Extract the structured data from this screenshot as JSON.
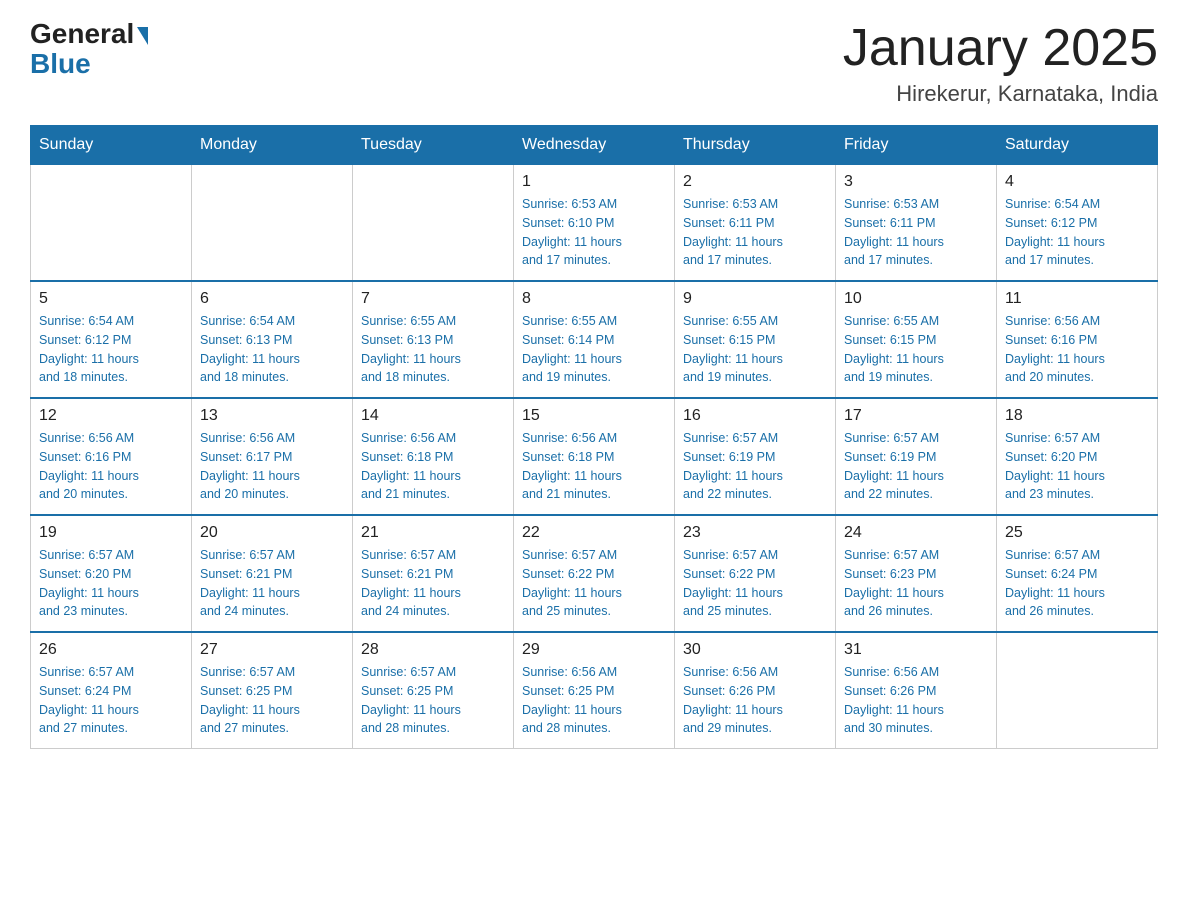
{
  "header": {
    "logo_general": "General",
    "logo_blue": "Blue",
    "title": "January 2025",
    "subtitle": "Hirekerur, Karnataka, India"
  },
  "weekdays": [
    "Sunday",
    "Monday",
    "Tuesday",
    "Wednesday",
    "Thursday",
    "Friday",
    "Saturday"
  ],
  "weeks": [
    [
      {
        "day": "",
        "info": ""
      },
      {
        "day": "",
        "info": ""
      },
      {
        "day": "",
        "info": ""
      },
      {
        "day": "1",
        "info": "Sunrise: 6:53 AM\nSunset: 6:10 PM\nDaylight: 11 hours\nand 17 minutes."
      },
      {
        "day": "2",
        "info": "Sunrise: 6:53 AM\nSunset: 6:11 PM\nDaylight: 11 hours\nand 17 minutes."
      },
      {
        "day": "3",
        "info": "Sunrise: 6:53 AM\nSunset: 6:11 PM\nDaylight: 11 hours\nand 17 minutes."
      },
      {
        "day": "4",
        "info": "Sunrise: 6:54 AM\nSunset: 6:12 PM\nDaylight: 11 hours\nand 17 minutes."
      }
    ],
    [
      {
        "day": "5",
        "info": "Sunrise: 6:54 AM\nSunset: 6:12 PM\nDaylight: 11 hours\nand 18 minutes."
      },
      {
        "day": "6",
        "info": "Sunrise: 6:54 AM\nSunset: 6:13 PM\nDaylight: 11 hours\nand 18 minutes."
      },
      {
        "day": "7",
        "info": "Sunrise: 6:55 AM\nSunset: 6:13 PM\nDaylight: 11 hours\nand 18 minutes."
      },
      {
        "day": "8",
        "info": "Sunrise: 6:55 AM\nSunset: 6:14 PM\nDaylight: 11 hours\nand 19 minutes."
      },
      {
        "day": "9",
        "info": "Sunrise: 6:55 AM\nSunset: 6:15 PM\nDaylight: 11 hours\nand 19 minutes."
      },
      {
        "day": "10",
        "info": "Sunrise: 6:55 AM\nSunset: 6:15 PM\nDaylight: 11 hours\nand 19 minutes."
      },
      {
        "day": "11",
        "info": "Sunrise: 6:56 AM\nSunset: 6:16 PM\nDaylight: 11 hours\nand 20 minutes."
      }
    ],
    [
      {
        "day": "12",
        "info": "Sunrise: 6:56 AM\nSunset: 6:16 PM\nDaylight: 11 hours\nand 20 minutes."
      },
      {
        "day": "13",
        "info": "Sunrise: 6:56 AM\nSunset: 6:17 PM\nDaylight: 11 hours\nand 20 minutes."
      },
      {
        "day": "14",
        "info": "Sunrise: 6:56 AM\nSunset: 6:18 PM\nDaylight: 11 hours\nand 21 minutes."
      },
      {
        "day": "15",
        "info": "Sunrise: 6:56 AM\nSunset: 6:18 PM\nDaylight: 11 hours\nand 21 minutes."
      },
      {
        "day": "16",
        "info": "Sunrise: 6:57 AM\nSunset: 6:19 PM\nDaylight: 11 hours\nand 22 minutes."
      },
      {
        "day": "17",
        "info": "Sunrise: 6:57 AM\nSunset: 6:19 PM\nDaylight: 11 hours\nand 22 minutes."
      },
      {
        "day": "18",
        "info": "Sunrise: 6:57 AM\nSunset: 6:20 PM\nDaylight: 11 hours\nand 23 minutes."
      }
    ],
    [
      {
        "day": "19",
        "info": "Sunrise: 6:57 AM\nSunset: 6:20 PM\nDaylight: 11 hours\nand 23 minutes."
      },
      {
        "day": "20",
        "info": "Sunrise: 6:57 AM\nSunset: 6:21 PM\nDaylight: 11 hours\nand 24 minutes."
      },
      {
        "day": "21",
        "info": "Sunrise: 6:57 AM\nSunset: 6:21 PM\nDaylight: 11 hours\nand 24 minutes."
      },
      {
        "day": "22",
        "info": "Sunrise: 6:57 AM\nSunset: 6:22 PM\nDaylight: 11 hours\nand 25 minutes."
      },
      {
        "day": "23",
        "info": "Sunrise: 6:57 AM\nSunset: 6:22 PM\nDaylight: 11 hours\nand 25 minutes."
      },
      {
        "day": "24",
        "info": "Sunrise: 6:57 AM\nSunset: 6:23 PM\nDaylight: 11 hours\nand 26 minutes."
      },
      {
        "day": "25",
        "info": "Sunrise: 6:57 AM\nSunset: 6:24 PM\nDaylight: 11 hours\nand 26 minutes."
      }
    ],
    [
      {
        "day": "26",
        "info": "Sunrise: 6:57 AM\nSunset: 6:24 PM\nDaylight: 11 hours\nand 27 minutes."
      },
      {
        "day": "27",
        "info": "Sunrise: 6:57 AM\nSunset: 6:25 PM\nDaylight: 11 hours\nand 27 minutes."
      },
      {
        "day": "28",
        "info": "Sunrise: 6:57 AM\nSunset: 6:25 PM\nDaylight: 11 hours\nand 28 minutes."
      },
      {
        "day": "29",
        "info": "Sunrise: 6:56 AM\nSunset: 6:25 PM\nDaylight: 11 hours\nand 28 minutes."
      },
      {
        "day": "30",
        "info": "Sunrise: 6:56 AM\nSunset: 6:26 PM\nDaylight: 11 hours\nand 29 minutes."
      },
      {
        "day": "31",
        "info": "Sunrise: 6:56 AM\nSunset: 6:26 PM\nDaylight: 11 hours\nand 30 minutes."
      },
      {
        "day": "",
        "info": ""
      }
    ]
  ]
}
